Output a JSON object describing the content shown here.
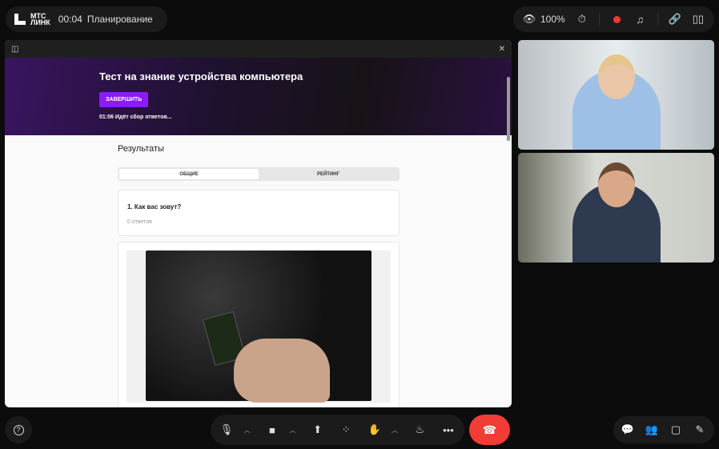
{
  "header": {
    "logo_line1": "МТС",
    "logo_line2": "ЛИНК",
    "timer": "00:04",
    "status": "Планирование",
    "viewers": "100%"
  },
  "banner": {
    "title": "Тест на знание устройства компьютера",
    "finish_button": "ЗАВЕРШИТЬ",
    "status": "01:06 Идёт сбор ответов..."
  },
  "results": {
    "title": "Результаты",
    "tabs": [
      {
        "label": "ОБЩИЕ",
        "active": true
      },
      {
        "label": "РЕЙТИНГ",
        "active": false
      }
    ],
    "questions": [
      {
        "title": "1. Как вас зовут?",
        "answers": "0 ответов"
      }
    ]
  },
  "colors": {
    "accent": "#8a1cf5",
    "record": "#f03a30",
    "hangup": "#f23c36"
  }
}
